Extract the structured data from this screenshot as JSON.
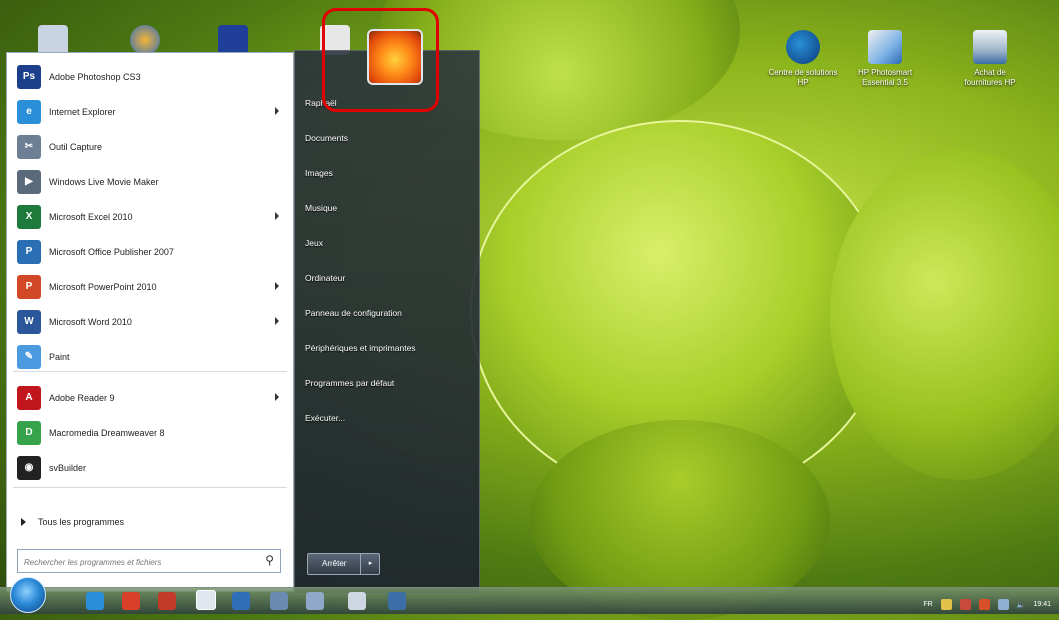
{
  "desktop": {
    "icons": [
      {
        "label": "Centre de solutions HP",
        "icon": "hp-logo-icon"
      },
      {
        "label": "HP Photosmart Essential 3.5",
        "icon": "photo-app-icon"
      },
      {
        "label": "Achat de fournitures HP",
        "icon": "printer-supplies-icon"
      }
    ]
  },
  "start_menu": {
    "programs": [
      {
        "label": "Adobe Photoshop CS3",
        "icon": "photoshop-icon",
        "glyph": "Ps",
        "color": "#1b3f8a",
        "submenu": false
      },
      {
        "label": "Internet Explorer",
        "icon": "internet-explorer-icon",
        "glyph": "e",
        "color": "#2a8fd8",
        "submenu": true
      },
      {
        "label": "Outil Capture",
        "icon": "snipping-tool-icon",
        "glyph": "✂",
        "color": "#6d7f95",
        "submenu": false
      },
      {
        "label": "Windows Live Movie Maker",
        "icon": "movie-maker-icon",
        "glyph": "▶",
        "color": "#5a6a7a",
        "submenu": false
      },
      {
        "label": "Microsoft Excel 2010",
        "icon": "excel-icon",
        "glyph": "X",
        "color": "#1d7a3a",
        "submenu": true
      },
      {
        "label": "Microsoft Office Publisher 2007",
        "icon": "publisher-icon",
        "glyph": "P",
        "color": "#2a6fb3",
        "submenu": false
      },
      {
        "label": "Microsoft PowerPoint 2010",
        "icon": "powerpoint-icon",
        "glyph": "P",
        "color": "#d24726",
        "submenu": true
      },
      {
        "label": "Microsoft Word 2010",
        "icon": "word-icon",
        "glyph": "W",
        "color": "#2b579a",
        "submenu": true
      },
      {
        "label": "Paint",
        "icon": "paint-icon",
        "glyph": "✎",
        "color": "#4c9be0",
        "submenu": false
      },
      {
        "label": "Adobe Reader 9",
        "icon": "adobe-reader-icon",
        "glyph": "A",
        "color": "#c0161b",
        "submenu": true
      },
      {
        "label": "Macromedia Dreamweaver 8",
        "icon": "dreamweaver-icon",
        "glyph": "D",
        "color": "#36a24a",
        "submenu": false
      },
      {
        "label": "svBuilder",
        "icon": "svbuilder-icon",
        "glyph": "◉",
        "color": "#222222",
        "submenu": false
      }
    ],
    "all_programs": "Tous les programmes",
    "search": {
      "placeholder": "Rechercher les programmes et fichiers"
    },
    "right_items": [
      "Raphaël",
      "Documents",
      "Images",
      "Musique",
      "Jeux",
      "Ordinateur",
      "Panneau de configuration",
      "Périphériques et imprimantes",
      "Programmes par défaut",
      "Exécuter..."
    ],
    "shutdown": "Arrêter"
  },
  "taskbar": {
    "language": "FR",
    "clock": "19:41"
  },
  "colors": {
    "highlight": "#e00000",
    "menu_left_bg": "#ffffff",
    "menu_right_bg": "#283040"
  }
}
